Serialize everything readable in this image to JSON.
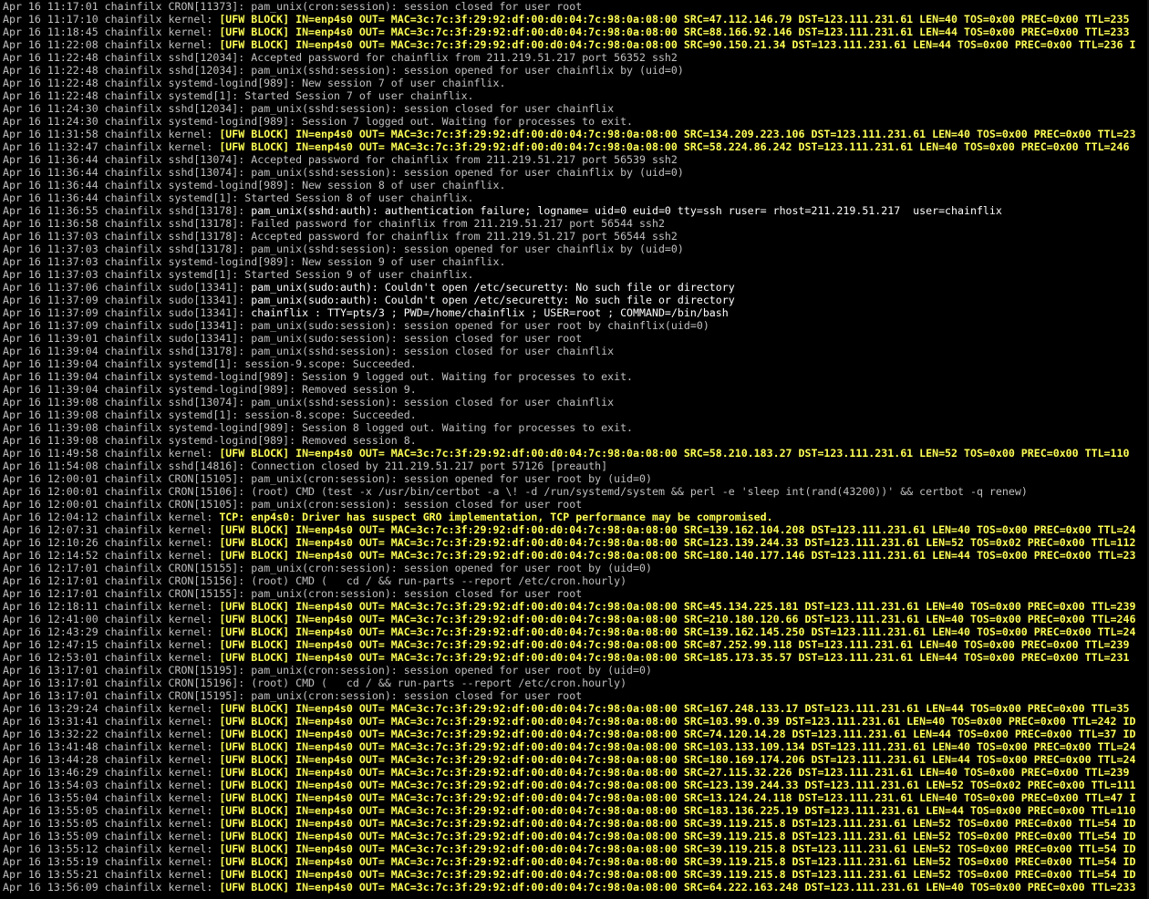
{
  "terminal": {
    "lines": [
      {
        "prefix": "Apr 16 11:17:01 chainfilx CRON[11373]: ",
        "msg": "pam_unix(cron:session): session closed for user root",
        "style": "normal"
      },
      {
        "prefix": "Apr 16 11:17:10 chainfilx kernel: ",
        "msg": "[UFW BLOCK] IN=enp4s0 OUT= MAC=3c:7c:3f:29:92:df:00:d0:04:7c:98:0a:08:00 SRC=47.112.146.79 DST=123.111.231.61 LEN=40 TOS=0x00 PREC=0x00 TTL=235",
        "style": "kernel"
      },
      {
        "prefix": "Apr 16 11:18:45 chainfilx kernel: ",
        "msg": "[UFW BLOCK] IN=enp4s0 OUT= MAC=3c:7c:3f:29:92:df:00:d0:04:7c:98:0a:08:00 SRC=88.166.92.146 DST=123.111.231.61 LEN=44 TOS=0x00 PREC=0x00 TTL=233",
        "style": "kernel"
      },
      {
        "prefix": "Apr 16 11:22:08 chainfilx kernel: ",
        "msg": "[UFW BLOCK] IN=enp4s0 OUT= MAC=3c:7c:3f:29:92:df:00:d0:04:7c:98:0a:08:00 SRC=90.150.21.34 DST=123.111.231.61 LEN=44 TOS=0x00 PREC=0x00 TTL=236 I",
        "style": "kernel"
      },
      {
        "prefix": "Apr 16 11:22:48 chainfilx sshd[12034]: ",
        "msg": "Accepted password for chainflix from 211.219.51.217 port 56352 ssh2",
        "style": "normal"
      },
      {
        "prefix": "Apr 16 11:22:48 chainfilx sshd[12034]: ",
        "msg": "pam_unix(sshd:session): session opened for user chainflix by (uid=0)",
        "style": "normal"
      },
      {
        "prefix": "Apr 16 11:22:48 chainfilx systemd-logind[989]: ",
        "msg": "New session 7 of user chainflix.",
        "style": "normal"
      },
      {
        "prefix": "Apr 16 11:22:48 chainfilx systemd[1]: ",
        "msg": "Started Session 7 of user chainflix.",
        "style": "normal"
      },
      {
        "prefix": "Apr 16 11:24:30 chainfilx sshd[12034]: ",
        "msg": "pam_unix(sshd:session): session closed for user chainflix",
        "style": "normal"
      },
      {
        "prefix": "Apr 16 11:24:30 chainfilx systemd-logind[989]: ",
        "msg": "Session 7 logged out. Waiting for processes to exit.",
        "style": "normal"
      },
      {
        "prefix": "Apr 16 11:31:58 chainfilx kernel: ",
        "msg": "[UFW BLOCK] IN=enp4s0 OUT= MAC=3c:7c:3f:29:92:df:00:d0:04:7c:98:0a:08:00 SRC=134.209.223.106 DST=123.111.231.61 LEN=40 TOS=0x00 PREC=0x00 TTL=23",
        "style": "kernel"
      },
      {
        "prefix": "Apr 16 11:32:47 chainfilx kernel: ",
        "msg": "[UFW BLOCK] IN=enp4s0 OUT= MAC=3c:7c:3f:29:92:df:00:d0:04:7c:98:0a:08:00 SRC=58.224.86.242 DST=123.111.231.61 LEN=40 TOS=0x00 PREC=0x00 TTL=246",
        "style": "kernel"
      },
      {
        "prefix": "Apr 16 11:36:44 chainfilx sshd[13074]: ",
        "msg": "Accepted password for chainflix from 211.219.51.217 port 56539 ssh2",
        "style": "normal"
      },
      {
        "prefix": "Apr 16 11:36:44 chainfilx sshd[13074]: ",
        "msg": "pam_unix(sshd:session): session opened for user chainflix by (uid=0)",
        "style": "normal"
      },
      {
        "prefix": "Apr 16 11:36:44 chainfilx systemd-logind[989]: ",
        "msg": "New session 8 of user chainflix.",
        "style": "normal"
      },
      {
        "prefix": "Apr 16 11:36:44 chainfilx systemd[1]: ",
        "msg": "Started Session 8 of user chainflix.",
        "style": "normal"
      },
      {
        "prefix": "Apr 16 11:36:55 chainfilx sshd[13178]: ",
        "msg": "pam_unix(sshd:auth): authentication failure; logname= uid=0 euid=0 tty=ssh ruser= rhost=211.219.51.217  user=chainflix",
        "style": "bright"
      },
      {
        "prefix": "Apr 16 11:36:58 chainfilx sshd[13178]: ",
        "msg": "Failed password for chainflix from 211.219.51.217 port 56544 ssh2",
        "style": "normal"
      },
      {
        "prefix": "Apr 16 11:37:03 chainfilx sshd[13178]: ",
        "msg": "Accepted password for chainflix from 211.219.51.217 port 56544 ssh2",
        "style": "normal"
      },
      {
        "prefix": "Apr 16 11:37:03 chainfilx sshd[13178]: ",
        "msg": "pam_unix(sshd:session): session opened for user chainflix by (uid=0)",
        "style": "normal"
      },
      {
        "prefix": "Apr 16 11:37:03 chainfilx systemd-logind[989]: ",
        "msg": "New session 9 of user chainflix.",
        "style": "normal"
      },
      {
        "prefix": "Apr 16 11:37:03 chainfilx systemd[1]: ",
        "msg": "Started Session 9 of user chainflix.",
        "style": "normal"
      },
      {
        "prefix": "Apr 16 11:37:06 chainfilx sudo[13341]: ",
        "msg": "pam_unix(sudo:auth): Couldn't open /etc/securetty: No such file or directory",
        "style": "bright"
      },
      {
        "prefix": "Apr 16 11:37:09 chainfilx sudo[13341]: ",
        "msg": "pam_unix(sudo:auth): Couldn't open /etc/securetty: No such file or directory",
        "style": "bright"
      },
      {
        "prefix": "Apr 16 11:37:09 chainfilx sudo[13341]: ",
        "msg": "chainflix : TTY=pts/3 ; PWD=/home/chainflix ; USER=root ; COMMAND=/bin/bash",
        "style": "bright"
      },
      {
        "prefix": "Apr 16 11:37:09 chainfilx sudo[13341]: ",
        "msg": "pam_unix(sudo:session): session opened for user root by chainflix(uid=0)",
        "style": "normal"
      },
      {
        "prefix": "Apr 16 11:39:01 chainfilx sudo[13341]: ",
        "msg": "pam_unix(sudo:session): session closed for user root",
        "style": "normal"
      },
      {
        "prefix": "Apr 16 11:39:04 chainfilx sshd[13178]: ",
        "msg": "pam_unix(sshd:session): session closed for user chainflix",
        "style": "normal"
      },
      {
        "prefix": "Apr 16 11:39:04 chainfilx systemd[1]: ",
        "msg": "session-9.scope: Succeeded.",
        "style": "normal"
      },
      {
        "prefix": "Apr 16 11:39:04 chainfilx systemd-logind[989]: ",
        "msg": "Session 9 logged out. Waiting for processes to exit.",
        "style": "normal"
      },
      {
        "prefix": "Apr 16 11:39:04 chainfilx systemd-logind[989]: ",
        "msg": "Removed session 9.",
        "style": "normal"
      },
      {
        "prefix": "Apr 16 11:39:08 chainfilx sshd[13074]: ",
        "msg": "pam_unix(sshd:session): session closed for user chainflix",
        "style": "normal"
      },
      {
        "prefix": "Apr 16 11:39:08 chainfilx systemd[1]: ",
        "msg": "session-8.scope: Succeeded.",
        "style": "normal"
      },
      {
        "prefix": "Apr 16 11:39:08 chainfilx systemd-logind[989]: ",
        "msg": "Session 8 logged out. Waiting for processes to exit.",
        "style": "normal"
      },
      {
        "prefix": "Apr 16 11:39:08 chainfilx systemd-logind[989]: ",
        "msg": "Removed session 8.",
        "style": "normal"
      },
      {
        "prefix": "Apr 16 11:49:58 chainfilx kernel: ",
        "msg": "[UFW BLOCK] IN=enp4s0 OUT= MAC=3c:7c:3f:29:92:df:00:d0:04:7c:98:0a:08:00 SRC=58.210.183.27 DST=123.111.231.61 LEN=52 TOS=0x00 PREC=0x00 TTL=110",
        "style": "kernel"
      },
      {
        "prefix": "Apr 16 11:54:08 chainfilx sshd[14816]: ",
        "msg": "Connection closed by 211.219.51.217 port 57126 [preauth]",
        "style": "normal"
      },
      {
        "prefix": "Apr 16 12:00:01 chainfilx CRON[15105]: ",
        "msg": "pam_unix(cron:session): session opened for user root by (uid=0)",
        "style": "normal"
      },
      {
        "prefix": "Apr 16 12:00:01 chainfilx CRON[15106]: ",
        "msg": "(root) CMD (test -x /usr/bin/certbot -a \\! -d /run/systemd/system && perl -e 'sleep int(rand(43200))' && certbot -q renew)",
        "style": "normal"
      },
      {
        "prefix": "Apr 16 12:00:01 chainfilx CRON[15105]: ",
        "msg": "pam_unix(cron:session): session closed for user root",
        "style": "normal"
      },
      {
        "prefix": "Apr 16 12:04:12 chainfilx kernel: ",
        "msg": "TCP: enp4s0: Driver has suspect GRO implementation, TCP performance may be compromised.",
        "style": "kernel"
      },
      {
        "prefix": "Apr 16 12:07:31 chainfilx kernel: ",
        "msg": "[UFW BLOCK] IN=enp4s0 OUT= MAC=3c:7c:3f:29:92:df:00:d0:04:7c:98:0a:08:00 SRC=139.162.104.208 DST=123.111.231.61 LEN=40 TOS=0x00 PREC=0x00 TTL=24",
        "style": "kernel"
      },
      {
        "prefix": "Apr 16 12:10:26 chainfilx kernel: ",
        "msg": "[UFW BLOCK] IN=enp4s0 OUT= MAC=3c:7c:3f:29:92:df:00:d0:04:7c:98:0a:08:00 SRC=123.139.244.33 DST=123.111.231.61 LEN=52 TOS=0x02 PREC=0x00 TTL=112",
        "style": "kernel"
      },
      {
        "prefix": "Apr 16 12:14:52 chainfilx kernel: ",
        "msg": "[UFW BLOCK] IN=enp4s0 OUT= MAC=3c:7c:3f:29:92:df:00:d0:04:7c:98:0a:08:00 SRC=180.140.177.146 DST=123.111.231.61 LEN=44 TOS=0x00 PREC=0x00 TTL=23",
        "style": "kernel"
      },
      {
        "prefix": "Apr 16 12:17:01 chainfilx CRON[15155]: ",
        "msg": "pam_unix(cron:session): session opened for user root by (uid=0)",
        "style": "normal"
      },
      {
        "prefix": "Apr 16 12:17:01 chainfilx CRON[15156]: ",
        "msg": "(root) CMD (   cd / && run-parts --report /etc/cron.hourly)",
        "style": "normal"
      },
      {
        "prefix": "Apr 16 12:17:01 chainfilx CRON[15155]: ",
        "msg": "pam_unix(cron:session): session closed for user root",
        "style": "normal"
      },
      {
        "prefix": "Apr 16 12:18:11 chainfilx kernel: ",
        "msg": "[UFW BLOCK] IN=enp4s0 OUT= MAC=3c:7c:3f:29:92:df:00:d0:04:7c:98:0a:08:00 SRC=45.134.225.181 DST=123.111.231.61 LEN=40 TOS=0x00 PREC=0x00 TTL=239",
        "style": "kernel"
      },
      {
        "prefix": "Apr 16 12:41:00 chainfilx kernel: ",
        "msg": "[UFW BLOCK] IN=enp4s0 OUT= MAC=3c:7c:3f:29:92:df:00:d0:04:7c:98:0a:08:00 SRC=210.180.120.66 DST=123.111.231.61 LEN=40 TOS=0x00 PREC=0x00 TTL=246",
        "style": "kernel"
      },
      {
        "prefix": "Apr 16 12:43:29 chainfilx kernel: ",
        "msg": "[UFW BLOCK] IN=enp4s0 OUT= MAC=3c:7c:3f:29:92:df:00:d0:04:7c:98:0a:08:00 SRC=139.162.145.250 DST=123.111.231.61 LEN=40 TOS=0x00 PREC=0x00 TTL=24",
        "style": "kernel"
      },
      {
        "prefix": "Apr 16 12:47:15 chainfilx kernel: ",
        "msg": "[UFW BLOCK] IN=enp4s0 OUT= MAC=3c:7c:3f:29:92:df:00:d0:04:7c:98:0a:08:00 SRC=87.252.99.118 DST=123.111.231.61 LEN=40 TOS=0x00 PREC=0x00 TTL=239",
        "style": "kernel"
      },
      {
        "prefix": "Apr 16 12:53:01 chainfilx kernel: ",
        "msg": "[UFW BLOCK] IN=enp4s0 OUT= MAC=3c:7c:3f:29:92:df:00:d0:04:7c:98:0a:08:00 SRC=185.173.35.57 DST=123.111.231.61 LEN=44 TOS=0x00 PREC=0x00 TTL=231",
        "style": "kernel"
      },
      {
        "prefix": "Apr 16 13:17:01 chainfilx CRON[15195]: ",
        "msg": "pam_unix(cron:session): session opened for user root by (uid=0)",
        "style": "normal"
      },
      {
        "prefix": "Apr 16 13:17:01 chainfilx CRON[15196]: ",
        "msg": "(root) CMD (   cd / && run-parts --report /etc/cron.hourly)",
        "style": "normal"
      },
      {
        "prefix": "Apr 16 13:17:01 chainfilx CRON[15195]: ",
        "msg": "pam_unix(cron:session): session closed for user root",
        "style": "normal"
      },
      {
        "prefix": "Apr 16 13:29:24 chainfilx kernel: ",
        "msg": "[UFW BLOCK] IN=enp4s0 OUT= MAC=3c:7c:3f:29:92:df:00:d0:04:7c:98:0a:08:00 SRC=167.248.133.17 DST=123.111.231.61 LEN=44 TOS=0x00 PREC=0x00 TTL=35",
        "style": "kernel"
      },
      {
        "prefix": "Apr 16 13:31:41 chainfilx kernel: ",
        "msg": "[UFW BLOCK] IN=enp4s0 OUT= MAC=3c:7c:3f:29:92:df:00:d0:04:7c:98:0a:08:00 SRC=103.99.0.39 DST=123.111.231.61 LEN=40 TOS=0x00 PREC=0x00 TTL=242 ID",
        "style": "kernel"
      },
      {
        "prefix": "Apr 16 13:32:22 chainfilx kernel: ",
        "msg": "[UFW BLOCK] IN=enp4s0 OUT= MAC=3c:7c:3f:29:92:df:00:d0:04:7c:98:0a:08:00 SRC=74.120.14.28 DST=123.111.231.61 LEN=44 TOS=0x00 PREC=0x00 TTL=37 ID",
        "style": "kernel"
      },
      {
        "prefix": "Apr 16 13:41:48 chainfilx kernel: ",
        "msg": "[UFW BLOCK] IN=enp4s0 OUT= MAC=3c:7c:3f:29:92:df:00:d0:04:7c:98:0a:08:00 SRC=103.133.109.134 DST=123.111.231.61 LEN=40 TOS=0x00 PREC=0x00 TTL=24",
        "style": "kernel"
      },
      {
        "prefix": "Apr 16 13:44:28 chainfilx kernel: ",
        "msg": "[UFW BLOCK] IN=enp4s0 OUT= MAC=3c:7c:3f:29:92:df:00:d0:04:7c:98:0a:08:00 SRC=180.169.174.206 DST=123.111.231.61 LEN=44 TOS=0x00 PREC=0x00 TTL=24",
        "style": "kernel"
      },
      {
        "prefix": "Apr 16 13:46:29 chainfilx kernel: ",
        "msg": "[UFW BLOCK] IN=enp4s0 OUT= MAC=3c:7c:3f:29:92:df:00:d0:04:7c:98:0a:08:00 SRC=27.115.32.226 DST=123.111.231.61 LEN=40 TOS=0x00 PREC=0x00 TTL=239",
        "style": "kernel"
      },
      {
        "prefix": "Apr 16 13:54:03 chainfilx kernel: ",
        "msg": "[UFW BLOCK] IN=enp4s0 OUT= MAC=3c:7c:3f:29:92:df:00:d0:04:7c:98:0a:08:00 SRC=123.139.244.33 DST=123.111.231.61 LEN=52 TOS=0x02 PREC=0x00 TTL=111",
        "style": "kernel"
      },
      {
        "prefix": "Apr 16 13:55:04 chainfilx kernel: ",
        "msg": "[UFW BLOCK] IN=enp4s0 OUT= MAC=3c:7c:3f:29:92:df:00:d0:04:7c:98:0a:08:00 SRC=13.124.24.118 DST=123.111.231.61 LEN=40 TOS=0x00 PREC=0x00 TTL=47 I",
        "style": "kernel"
      },
      {
        "prefix": "Apr 16 13:55:05 chainfilx kernel: ",
        "msg": "[UFW BLOCK] IN=enp4s0 OUT= MAC=3c:7c:3f:29:92:df:00:d0:04:7c:98:0a:08:00 SRC=183.136.225.19 DST=123.111.231.61 LEN=44 TOS=0x00 PREC=0x00 TTL=110",
        "style": "kernel"
      },
      {
        "prefix": "Apr 16 13:55:05 chainfilx kernel: ",
        "msg": "[UFW BLOCK] IN=enp4s0 OUT= MAC=3c:7c:3f:29:92:df:00:d0:04:7c:98:0a:08:00 SRC=39.119.215.8 DST=123.111.231.61 LEN=52 TOS=0x00 PREC=0x00 TTL=54 ID",
        "style": "kernel"
      },
      {
        "prefix": "Apr 16 13:55:09 chainfilx kernel: ",
        "msg": "[UFW BLOCK] IN=enp4s0 OUT= MAC=3c:7c:3f:29:92:df:00:d0:04:7c:98:0a:08:00 SRC=39.119.215.8 DST=123.111.231.61 LEN=52 TOS=0x00 PREC=0x00 TTL=54 ID",
        "style": "kernel"
      },
      {
        "prefix": "Apr 16 13:55:12 chainfilx kernel: ",
        "msg": "[UFW BLOCK] IN=enp4s0 OUT= MAC=3c:7c:3f:29:92:df:00:d0:04:7c:98:0a:08:00 SRC=39.119.215.8 DST=123.111.231.61 LEN=52 TOS=0x00 PREC=0x00 TTL=54 ID",
        "style": "kernel"
      },
      {
        "prefix": "Apr 16 13:55:19 chainfilx kernel: ",
        "msg": "[UFW BLOCK] IN=enp4s0 OUT= MAC=3c:7c:3f:29:92:df:00:d0:04:7c:98:0a:08:00 SRC=39.119.215.8 DST=123.111.231.61 LEN=52 TOS=0x00 PREC=0x00 TTL=54 ID",
        "style": "kernel"
      },
      {
        "prefix": "Apr 16 13:55:21 chainfilx kernel: ",
        "msg": "[UFW BLOCK] IN=enp4s0 OUT= MAC=3c:7c:3f:29:92:df:00:d0:04:7c:98:0a:08:00 SRC=39.119.215.8 DST=123.111.231.61 LEN=52 TOS=0x00 PREC=0x00 TTL=54 ID",
        "style": "kernel"
      },
      {
        "prefix": "Apr 16 13:56:09 chainfilx kernel: ",
        "msg": "[UFW BLOCK] IN=enp4s0 OUT= MAC=3c:7c:3f:29:92:df:00:d0:04:7c:98:0a:08:00 SRC=64.222.163.248 DST=123.111.231.61 LEN=40 TOS=0x00 PREC=0x00 TTL=233",
        "style": "kernel"
      }
    ],
    "colors": {
      "background": "#000000",
      "text": "#c0c0c0",
      "kernel_highlight": "#ffff54",
      "bright_text": "#ffffff"
    }
  }
}
